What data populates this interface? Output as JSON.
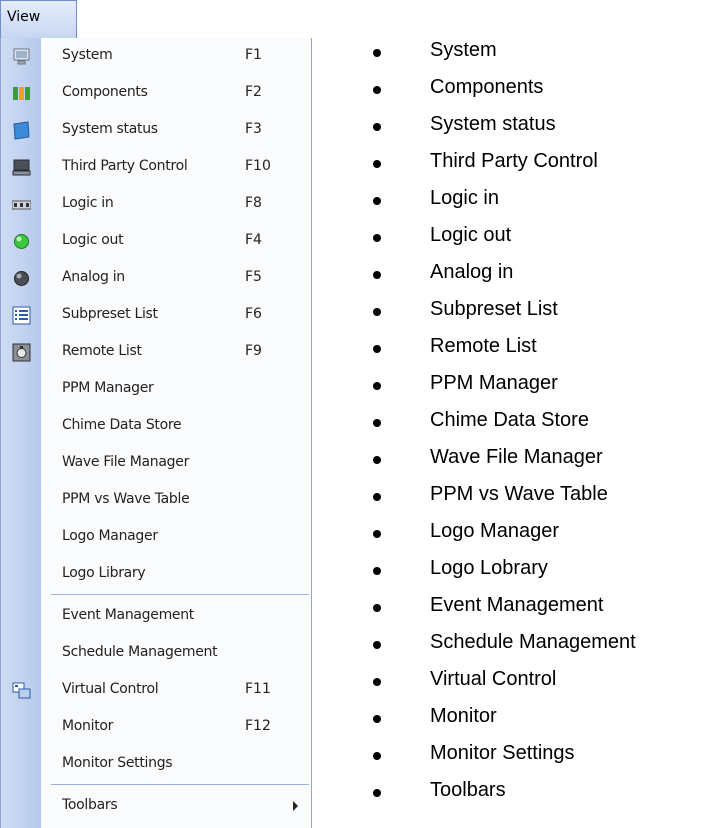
{
  "menubar": {
    "title": "View"
  },
  "menu": {
    "items": [
      {
        "label": "System",
        "key": "F1",
        "icon": "system-icon"
      },
      {
        "label": "Components",
        "key": "F2",
        "icon": "components-icon"
      },
      {
        "label": "System status",
        "key": "F3",
        "icon": "system-status-icon"
      },
      {
        "label": "Third Party Control",
        "key": "F10",
        "icon": "monitor-icon"
      },
      {
        "label": "Logic in",
        "key": "F8",
        "icon": "logic-in-icon"
      },
      {
        "label": "Logic out",
        "key": "F4",
        "icon": "green-led-icon"
      },
      {
        "label": "Analog in",
        "key": "F5",
        "icon": "gray-led-icon"
      },
      {
        "label": "Subpreset List",
        "key": "F6",
        "icon": "list-icon"
      },
      {
        "label": "Remote List",
        "key": "F9",
        "icon": "remote-icon"
      },
      {
        "label": "PPM Manager",
        "key": ""
      },
      {
        "label": "Chime Data Store",
        "key": ""
      },
      {
        "label": "Wave File Manager",
        "key": ""
      },
      {
        "label": "PPM vs Wave Table",
        "key": ""
      },
      {
        "label": "Logo Manager",
        "key": ""
      },
      {
        "label": "Logo Library",
        "key": ""
      },
      {
        "label": "Event Management",
        "key": ""
      },
      {
        "label": "Schedule Management",
        "key": ""
      },
      {
        "label": "Virtual Control",
        "key": "F11",
        "icon": "virtual-control-icon"
      },
      {
        "label": "Monitor",
        "key": "F12"
      },
      {
        "label": "Monitor Settings",
        "key": ""
      },
      {
        "label": "Toolbars",
        "key": "",
        "submenu": true
      }
    ]
  },
  "bullets": [
    "System",
    "Components",
    "System status",
    "Third Party Control",
    "Logic in",
    "Logic out",
    "Analog in",
    "Subpreset List",
    "Remote List",
    "PPM Manager",
    "Chime Data Store",
    "Wave File Manager",
    "PPM vs Wave Table",
    "Logo Manager",
    "Logo Lobrary",
    "Event Management",
    "Schedule Management",
    "Virtual Control",
    "Monitor",
    "Monitor Settings",
    "Toolbars"
  ],
  "colors": {
    "menu_bg": "#fafbfd",
    "icon_strip": "#b6c9ec",
    "border": "#8fa7cf"
  }
}
